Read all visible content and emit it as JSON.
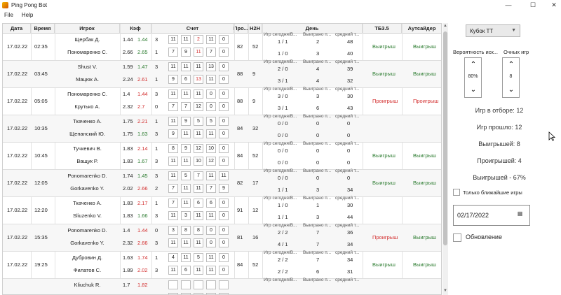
{
  "window": {
    "title": "Ping Pong Bot",
    "min": "—",
    "max": "☐",
    "close": "✕"
  },
  "menu": [
    "File",
    "Help"
  ],
  "columns": [
    "Дата",
    "Время",
    "Игрок",
    "Кэф",
    "Счет",
    "Про...",
    "Н2Н",
    "День",
    "ТБ3.5",
    "Аутсайдер"
  ],
  "rows": [
    {
      "date": "17.02.22",
      "time": "02:35",
      "p1": "Щербак Д.",
      "p2": "Пономаренко С.",
      "k1a": "1.44",
      "k1b": "1.44",
      "k1c": "green",
      "k2a": "2.66",
      "k2b": "2.65",
      "k2c": "green",
      "sets1": "3",
      "sets2": "1",
      "s1": [
        "11",
        "11",
        "2",
        "11",
        "0"
      ],
      "s2": [
        "7",
        "9",
        "11",
        "7",
        "0"
      ],
      "r1": [
        "",
        "",
        "red",
        "",
        ""
      ],
      "r2": [
        "",
        "",
        "red",
        "",
        ""
      ],
      "pro": "82",
      "h2h": "52",
      "d1": [
        "1 / 1",
        "2",
        "48"
      ],
      "d2": [
        "1 / 0",
        "3",
        "40"
      ],
      "tb": "Выигрыш",
      "tbc": "green",
      "out": "Выигрыш",
      "outc": "green"
    },
    {
      "date": "17.02.22",
      "time": "03:45",
      "p1": "Shust V.",
      "p2": "Мацюк А.",
      "k1a": "1.59",
      "k1b": "1.47",
      "k1c": "green",
      "k2a": "2.24",
      "k2b": "2.61",
      "k2c": "red",
      "sets1": "3",
      "sets2": "1",
      "s1": [
        "11",
        "11",
        "11",
        "13",
        "0"
      ],
      "s2": [
        "9",
        "6",
        "13",
        "11",
        "0"
      ],
      "r1": [
        "",
        "",
        "",
        "",
        ""
      ],
      "r2": [
        "",
        "",
        "red",
        "",
        ""
      ],
      "pro": "88",
      "h2h": "9",
      "d1": [
        "2 / 0",
        "4",
        "39"
      ],
      "d2": [
        "3 / 1",
        "4",
        "32"
      ],
      "tb": "Выигрыш",
      "tbc": "green",
      "out": "Выигрыш",
      "outc": "green"
    },
    {
      "date": "17.02.22",
      "time": "05:05",
      "p1": "Пономаренко С.",
      "p2": "Крутько А.",
      "k1a": "1.4",
      "k1b": "1.44",
      "k1c": "red",
      "k2a": "2.32",
      "k2b": "2.7",
      "k2c": "red",
      "sets1": "3",
      "sets2": "0",
      "s1": [
        "11",
        "11",
        "11",
        "0",
        "0"
      ],
      "s2": [
        "7",
        "7",
        "12",
        "0",
        "0"
      ],
      "r1": [
        "",
        "",
        "",
        "",
        ""
      ],
      "r2": [
        "",
        "",
        "",
        "",
        ""
      ],
      "pro": "88",
      "h2h": "9",
      "d1": [
        "3 / 0",
        "3",
        "30"
      ],
      "d2": [
        "3 / 1",
        "6",
        "43"
      ],
      "tb": "Проигрыш",
      "tbc": "red",
      "out": "Проигрыш",
      "outc": "red"
    },
    {
      "date": "17.02.22",
      "time": "10:35",
      "p1": "Ткаченко А.",
      "p2": "Щепанский Ю.",
      "k1a": "1.75",
      "k1b": "2.21",
      "k1c": "red",
      "k2a": "1.75",
      "k2b": "1.63",
      "k2c": "green",
      "sets1": "1",
      "sets2": "3",
      "s1": [
        "11",
        "9",
        "5",
        "5",
        "0"
      ],
      "s2": [
        "9",
        "11",
        "11",
        "11",
        "0"
      ],
      "r1": [
        "",
        "",
        "",
        "",
        ""
      ],
      "r2": [
        "",
        "",
        "",
        "",
        ""
      ],
      "pro": "84",
      "h2h": "32",
      "d1": [
        "0 / 0",
        "0",
        "0"
      ],
      "d2": [
        "0 / 0",
        "0",
        "0"
      ],
      "tb": "",
      "tbc": "green",
      "out": "",
      "outc": "green"
    },
    {
      "date": "17.02.22",
      "time": "10:45",
      "p1": "Тучкевич В.",
      "p2": "Ващук Р.",
      "k1a": "1.83",
      "k1b": "2.14",
      "k1c": "red",
      "k2a": "1.83",
      "k2b": "1.67",
      "k2c": "green",
      "sets1": "1",
      "sets2": "3",
      "s1": [
        "8",
        "9",
        "12",
        "10",
        "0"
      ],
      "s2": [
        "11",
        "11",
        "10",
        "12",
        "0"
      ],
      "r1": [
        "",
        "",
        "",
        "",
        ""
      ],
      "r2": [
        "",
        "",
        "",
        "",
        ""
      ],
      "pro": "84",
      "h2h": "52",
      "d1": [
        "0 / 0",
        "0",
        "0"
      ],
      "d2": [
        "0 / 0",
        "0",
        "0"
      ],
      "tb": "Выигрыш",
      "tbc": "green",
      "out": "Выигрыш",
      "outc": "green"
    },
    {
      "date": "17.02.22",
      "time": "12:05",
      "p1": "Ponomarenko D.",
      "p2": "Gorkavenko Y.",
      "k1a": "1.74",
      "k1b": "1.45",
      "k1c": "green",
      "k2a": "2.02",
      "k2b": "2.66",
      "k2c": "red",
      "sets1": "3",
      "sets2": "2",
      "s1": [
        "11",
        "5",
        "7",
        "11",
        "11"
      ],
      "s2": [
        "7",
        "11",
        "11",
        "7",
        "9"
      ],
      "r1": [
        "",
        "",
        "",
        "",
        ""
      ],
      "r2": [
        "",
        "",
        "",
        "",
        ""
      ],
      "pro": "82",
      "h2h": "17",
      "d1": [
        "0 / 0",
        "0",
        "0"
      ],
      "d2": [
        "1 / 1",
        "3",
        "34"
      ],
      "tb": "Выигрыш",
      "tbc": "green",
      "out": "Выигрыш",
      "outc": "green"
    },
    {
      "date": "17.02.22",
      "time": "12:20",
      "p1": "Ткаченко А.",
      "p2": "Sliuzenko V.",
      "k1a": "1.83",
      "k1b": "2.17",
      "k1c": "red",
      "k2a": "1.83",
      "k2b": "1.66",
      "k2c": "green",
      "sets1": "1",
      "sets2": "3",
      "s1": [
        "7",
        "11",
        "6",
        "6",
        "0"
      ],
      "s2": [
        "11",
        "3",
        "11",
        "11",
        "0"
      ],
      "r1": [
        "",
        "",
        "",
        "",
        ""
      ],
      "r2": [
        "",
        "",
        "",
        "",
        ""
      ],
      "pro": "91",
      "h2h": "12",
      "d1": [
        "1 / 0",
        "1",
        "30"
      ],
      "d2": [
        "1 / 1",
        "3",
        "44"
      ],
      "tb": "",
      "tbc": "green",
      "out": "",
      "outc": "green"
    },
    {
      "date": "17.02.22",
      "time": "15:35",
      "p1": "Ponomarenko D.",
      "p2": "Gorkavenko Y.",
      "k1a": "1.4",
      "k1b": "1.44",
      "k1c": "red",
      "k2a": "2.32",
      "k2b": "2.66",
      "k2c": "red",
      "sets1": "0",
      "sets2": "3",
      "s1": [
        "3",
        "8",
        "8",
        "0",
        "0"
      ],
      "s2": [
        "11",
        "11",
        "11",
        "0",
        "0"
      ],
      "r1": [
        "",
        "",
        "",
        "",
        ""
      ],
      "r2": [
        "",
        "",
        "",
        "",
        ""
      ],
      "pro": "81",
      "h2h": "16",
      "d1": [
        "2 / 2",
        "7",
        "36"
      ],
      "d2": [
        "4 / 1",
        "7",
        "34"
      ],
      "tb": "Проигрыш",
      "tbc": "red",
      "out": "Выигрыш",
      "outc": "green"
    },
    {
      "date": "17.02.22",
      "time": "19:25",
      "p1": "Дубровин Д.",
      "p2": "Филатов С.",
      "k1a": "1.63",
      "k1b": "1.74",
      "k1c": "red",
      "k2a": "1.89",
      "k2b": "2.02",
      "k2c": "red",
      "sets1": "1",
      "sets2": "3",
      "s1": [
        "4",
        "11",
        "5",
        "11",
        "0"
      ],
      "s2": [
        "11",
        "6",
        "11",
        "11",
        "0"
      ],
      "r1": [
        "",
        "",
        "",
        "",
        ""
      ],
      "r2": [
        "",
        "",
        "",
        "",
        ""
      ],
      "pro": "84",
      "h2h": "52",
      "d1": [
        "2 / 2",
        "7",
        "34"
      ],
      "d2": [
        "2 / 2",
        "6",
        "31"
      ],
      "tb": "Выигрыш",
      "tbc": "green",
      "out": "Выигрыш",
      "outc": "green"
    },
    {
      "date": "",
      "time": "",
      "p1": "Kliuchuk R.",
      "p2": "",
      "k1a": "1.7",
      "k1b": "1.82",
      "k1c": "red",
      "k2a": "",
      "k2b": "",
      "k2c": "red",
      "sets1": "",
      "sets2": "",
      "s1": [
        "",
        "",
        "",
        "",
        ""
      ],
      "s2": [
        "",
        "",
        "",
        "",
        ""
      ],
      "r1": [
        "",
        "",
        "",
        "",
        ""
      ],
      "r2": [
        "",
        "",
        "",
        "",
        ""
      ],
      "pro": "",
      "h2h": "",
      "d1": [
        "",
        "",
        ""
      ],
      "d2": [
        "",
        "",
        ""
      ],
      "tb": "",
      "tbc": "green",
      "out": "",
      "outc": "green"
    }
  ],
  "day_headers": [
    "Игр сегодня/В...",
    "Выиграно п...",
    "средний т..."
  ],
  "sidebar": {
    "combo": "Кубок ТТ",
    "prob_label": "Вероятность иск...",
    "points_label": "Очных игр",
    "prob_value": "80%",
    "points_value": "8",
    "stats": [
      "Игр в отборе: 12",
      "Игр прошло: 12",
      "Выигрышей: 8",
      "Проигрышей: 4",
      "Выигрышей - 67%"
    ],
    "near_games": "Только ближайшие игры",
    "date": "02/17/2022",
    "refresh": "Обновление"
  },
  "colors": {
    "win": "#2e7d32",
    "lose": "#d32f2f"
  }
}
